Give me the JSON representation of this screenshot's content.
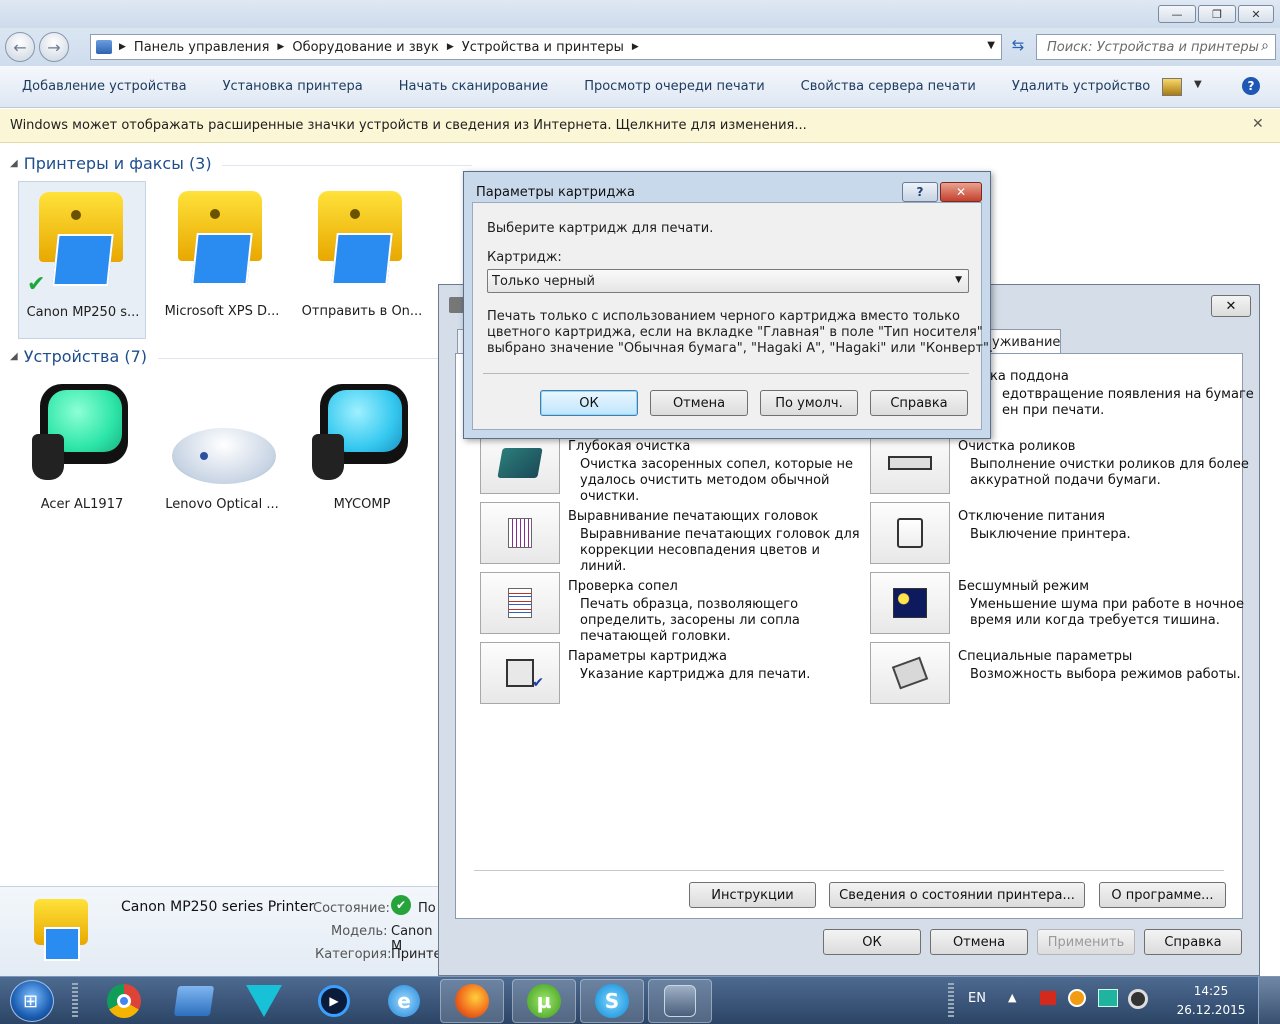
{
  "window": {
    "min_label": "—",
    "max_label": "❐",
    "close_label": "✕"
  },
  "address": {
    "crumbs": [
      "Панель управления",
      "Оборудование и звук",
      "Устройства и принтеры"
    ],
    "search_placeholder": "Поиск: Устройства и принтеры"
  },
  "toolbar": {
    "items": [
      "Добавление устройства",
      "Установка принтера",
      "Начать сканирование",
      "Просмотр очереди печати",
      "Свойства сервера печати",
      "Удалить устройство"
    ]
  },
  "infobar": {
    "text": "Windows может отображать расширенные значки устройств и сведения из Интернета.  Щелкните для изменения..."
  },
  "groups": {
    "printers": {
      "title": "Принтеры и факсы (3)",
      "items": [
        "Canon MP250 s...",
        "Microsoft XPS D...",
        "Отправить в On..."
      ]
    },
    "devices": {
      "title": "Устройства (7)",
      "items": [
        "Acer AL1917",
        "Lenovo Optical ...",
        "MYCOMP"
      ]
    }
  },
  "details": {
    "name": "Canon MP250 series Printer",
    "state_label": "Состояние:",
    "state_value": "По",
    "model_label": "Модель:",
    "model_value": "Canon M",
    "category_label": "Категория:",
    "category_value": "Принте"
  },
  "prefs": {
    "tab_label": "уживание",
    "items": [
      {
        "title": "ка поддона",
        "desc": "едотвращение появления на бумаге\nен при печати."
      },
      {
        "title": "Глубокая очистка",
        "desc": "Очистка засоренных сопел, которые не\nудалось очистить методом обычной\nочистки."
      },
      {
        "title": "Очистка роликов",
        "desc": "Выполнение очистки роликов для более\nаккуратной подачи бумаги."
      },
      {
        "title": "Выравнивание печатающих головок",
        "desc": "Выравнивание печатающих головок для\nкоррекции несовпадения цветов и\nлиний."
      },
      {
        "title": "Отключение питания",
        "desc": "Выключение принтера."
      },
      {
        "title": "Проверка сопел",
        "desc": "Печать образца, позволяющего\nопределить, засорены ли сопла\nпечатающей головки."
      },
      {
        "title": "Бесшумный режим",
        "desc": "Уменьшение шума при работе в ночное\nвремя или когда требуется тишина."
      },
      {
        "title": "Параметры картриджа",
        "desc": "Указание картриджа для печати."
      },
      {
        "title": "Специальные параметры",
        "desc": "Возможность выбора режимов работы."
      }
    ],
    "btn_instructions": "Инструкции",
    "btn_status": "Сведения о состоянии принтера...",
    "btn_about": "О программе...",
    "btn_ok": "ОК",
    "btn_cancel": "Отмена",
    "btn_apply": "Применить",
    "btn_help": "Справка"
  },
  "dialog": {
    "title": "Параметры картриджа",
    "prompt": "Выберите картридж для печати.",
    "cartridge_label": "Картридж:",
    "cartridge_value": "Только черный",
    "description": "Печать только с использованием черного картриджа вместо только\nцветного картриджа, если на вкладке \"Главная\" в поле \"Тип носителя\"\nвыбрано значение \"Обычная бумага\", \"Hagaki A\", \"Hagaki\" или \"Конверт\".",
    "btn_ok": "ОК",
    "btn_cancel": "Отмена",
    "btn_default": "По умолч.",
    "btn_help": "Справка",
    "help_glyph": "?",
    "close_glyph": "✕"
  },
  "taskbar": {
    "lang": "EN",
    "time": "14:25",
    "date": "26.12.2015"
  },
  "colors": {
    "accent": "#1e4e8c",
    "printer_yellow": "#f5c400",
    "monitor_green": "#2ee6a8",
    "monitor_cyan": "#36c9f0",
    "taskbar": "#2c4566"
  }
}
